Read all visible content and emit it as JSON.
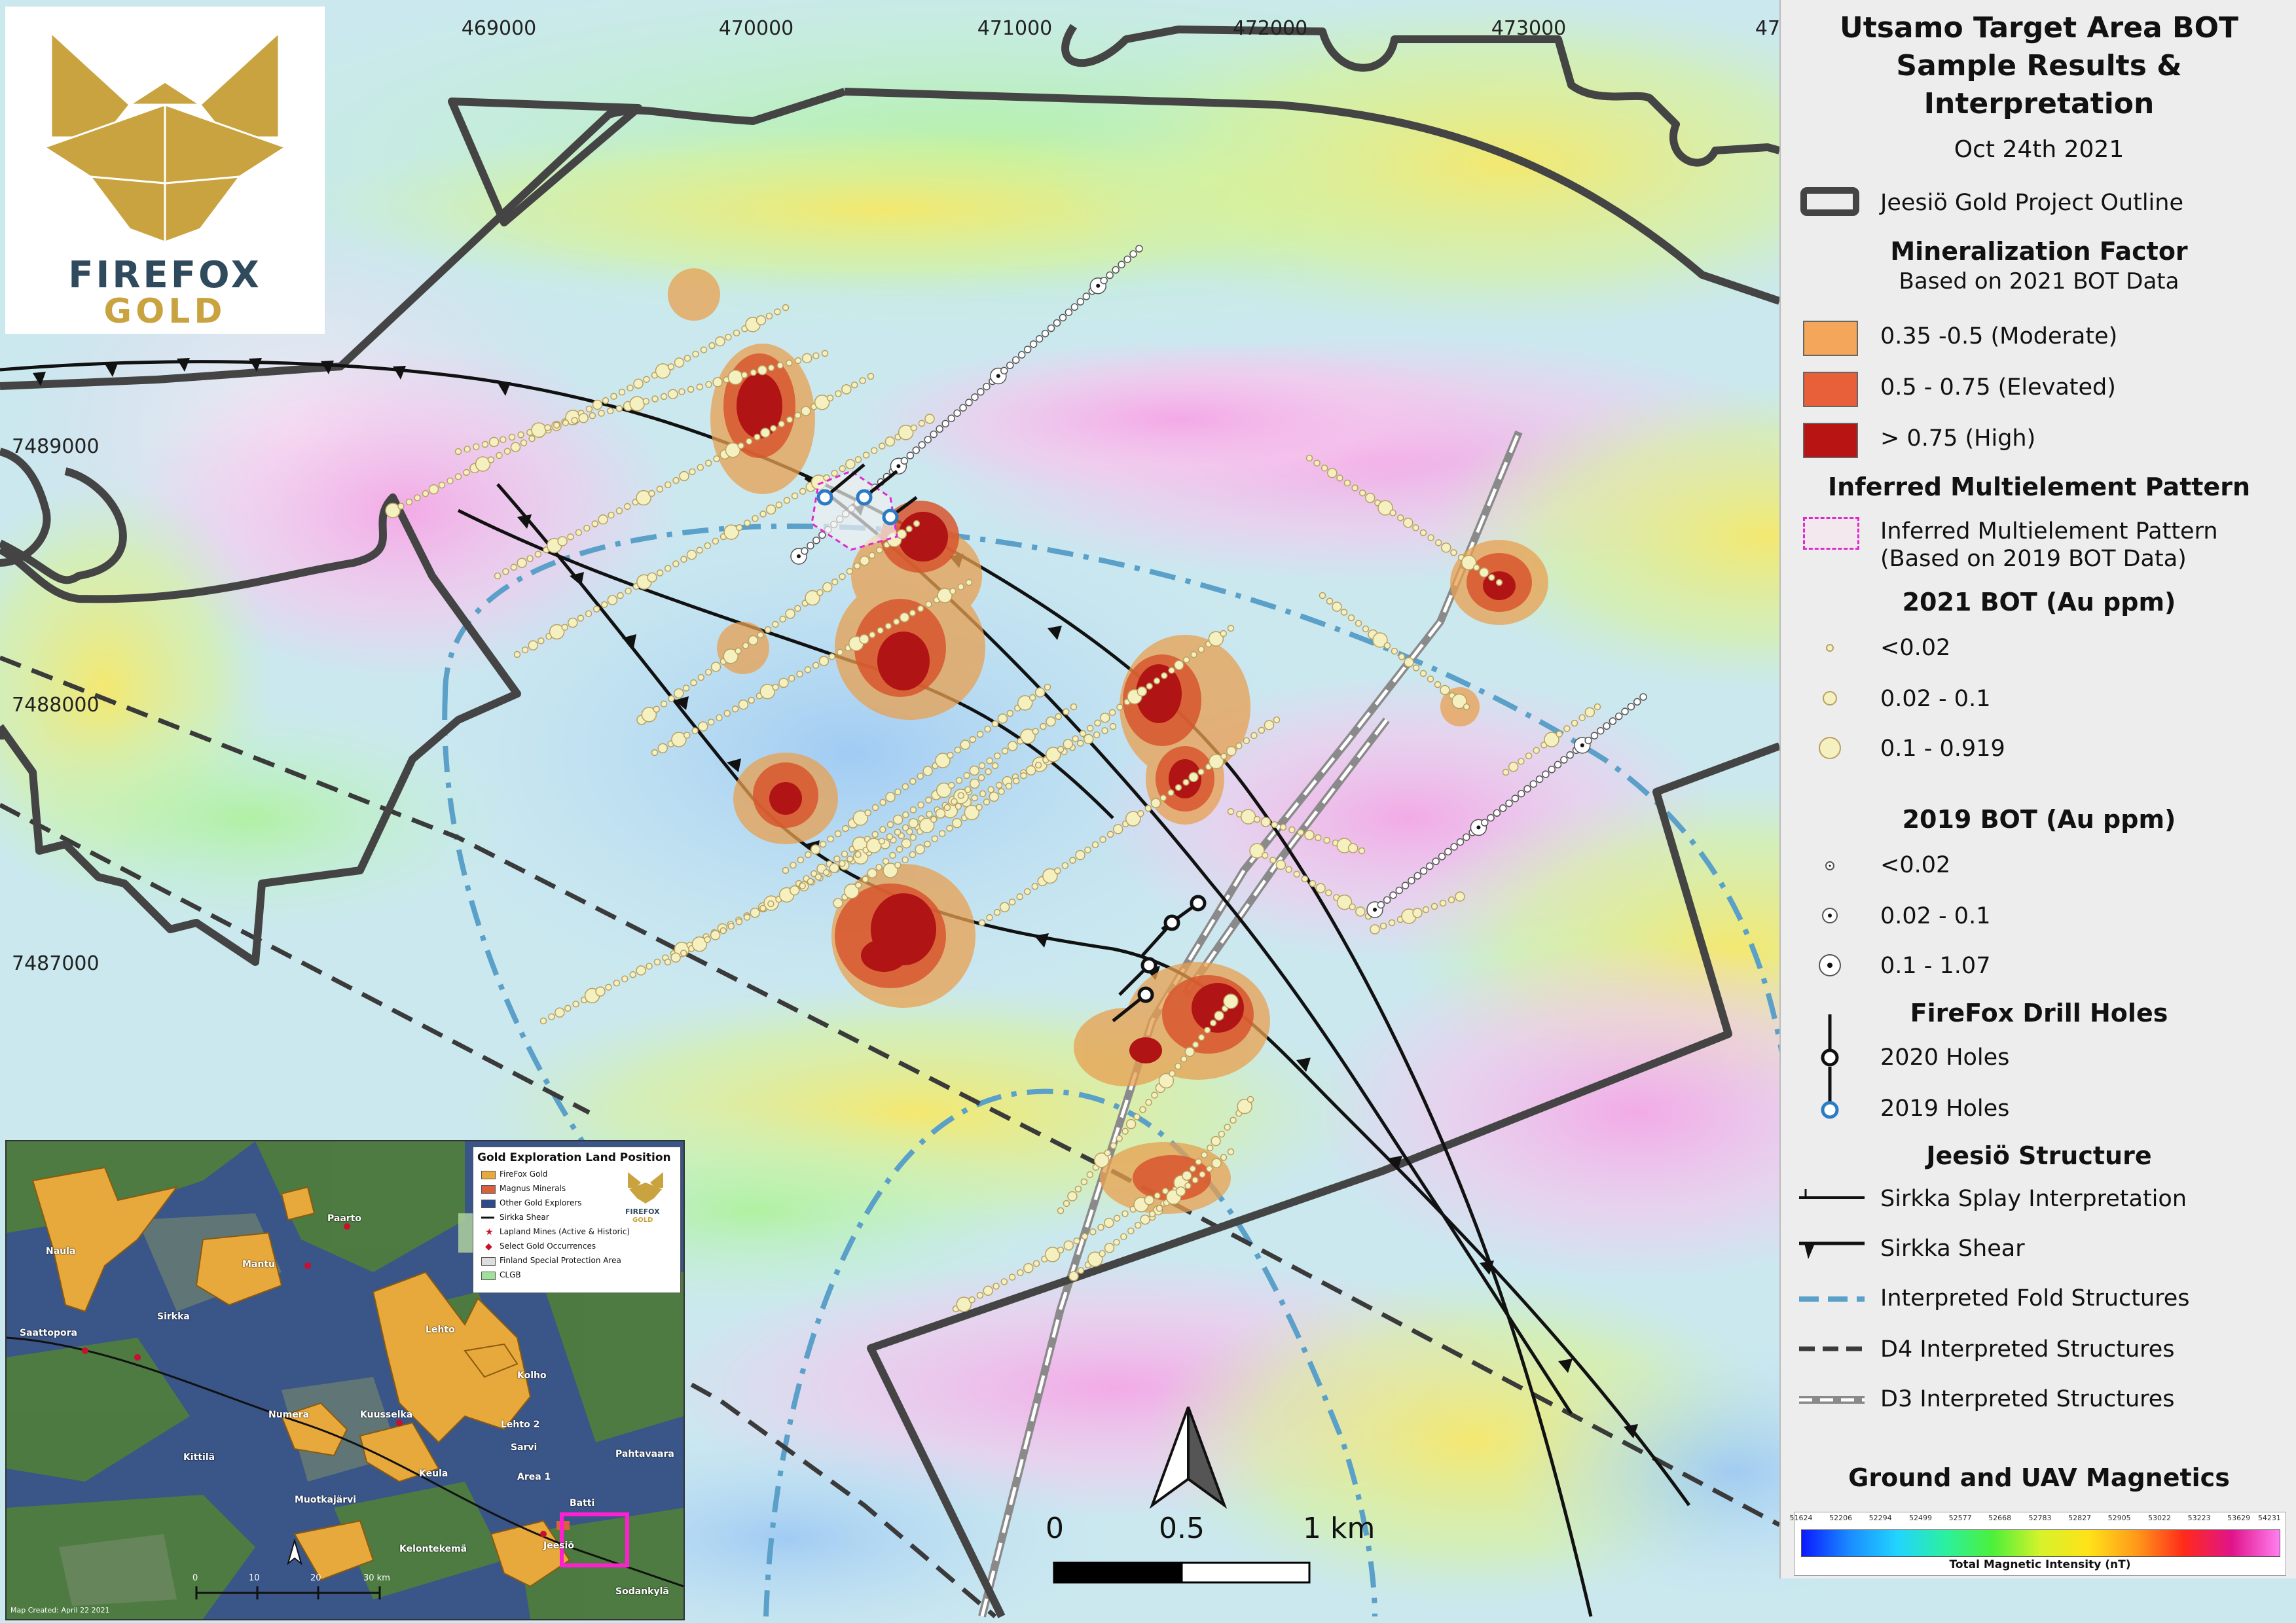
{
  "map": {
    "x_coords": [
      "469000",
      "470000",
      "471000",
      "472000",
      "473000",
      "47"
    ],
    "y_coords": [
      "7489000",
      "7488000",
      "7487000"
    ],
    "north_arrow": "north-arrow",
    "scale": {
      "zero": "0",
      "half": "0.5",
      "one": "1 km"
    }
  },
  "logo": {
    "line1": "FIREFOX",
    "line2": "GOLD",
    "primary_color": "#c9a33f",
    "text_color": "#2f4a5c"
  },
  "legend": {
    "title_lines": [
      "Utsamo Target Area BOT",
      "Sample Results &",
      "Interpretation"
    ],
    "date": "Oct 24th 2021",
    "outline_label": "Jeesiö Gold Project Outline",
    "mineralization": {
      "title": "Mineralization Factor",
      "subtitle": "Based on 2021 BOT Data",
      "classes": [
        {
          "label": "0.35 -0.5 (Moderate)",
          "color": "#f4a75a"
        },
        {
          "label": "0.5 - 0.75 (Elevated)",
          "color": "#e8603a"
        },
        {
          "label": "> 0.75 (High)",
          "color": "#b81414"
        }
      ]
    },
    "multielement": {
      "title": "Inferred Multielement Pattern",
      "line1": "Inferred Multielement Pattern",
      "line2": "(Based on 2019 BOT Data)"
    },
    "bot2021": {
      "title": "2021 BOT (Au ppm)",
      "classes": [
        "<0.02",
        "0.02 - 0.1",
        "0.1 - 0.919"
      ]
    },
    "bot2019": {
      "title": "2019 BOT (Au ppm)",
      "classes": [
        "<0.02",
        "0.02 - 0.1",
        "0.1 - 1.07"
      ]
    },
    "drill": {
      "title": "FireFox Drill Holes",
      "holes2020": "2020 Holes",
      "holes2019": "2019 Holes"
    },
    "structure": {
      "title": "Jeesiö Structure",
      "items": [
        "Sirkka Splay Interpretation",
        "Sirkka Shear",
        "Interpreted Fold Structures",
        "D4 Interpreted Structures",
        "D3 Interpreted Structures"
      ],
      "fold_color": "#5aa0c8"
    },
    "magnetics": {
      "title": "Ground and UAV Magnetics",
      "ticks": [
        "51624",
        "52206",
        "52294",
        "52499",
        "52577",
        "52668",
        "52783",
        "52827",
        "52905",
        "53022",
        "53223",
        "53629",
        "54231"
      ],
      "label": "Total Magnetic Intensity (nT)"
    }
  },
  "inset": {
    "title": "Gold Exploration Land Position",
    "legend_items": [
      {
        "label": "FireFox Gold",
        "color": "#e8a93c"
      },
      {
        "label": "Magnus Minerals",
        "color": "#d9603a"
      },
      {
        "label": "Other Gold Explorers",
        "color": "#2f4a8a"
      },
      {
        "label": "Sirkka Shear",
        "color": "#111111"
      },
      {
        "label": "Lapland Mines (Active & Historic)",
        "color": "#c8102e"
      },
      {
        "label": "Select Gold Occurrences",
        "color": "#c8102e"
      },
      {
        "label": "Finland Special Protection Area",
        "color": "#dddddd"
      },
      {
        "label": "CLGB",
        "color": "#9fe09a"
      }
    ],
    "logo_line1": "FIREFOX",
    "logo_line2": "GOLD",
    "place_labels": [
      "Naula",
      "Mantu",
      "Paarto",
      "Lehto",
      "Kolho",
      "Numera",
      "Kuusselka",
      "Lehto 2",
      "Sarvi",
      "Keula",
      "Muotkajärvi",
      "Kelontekemä",
      "Jeesiö",
      "Sodankylä",
      "Kittilä",
      "Saattopora",
      "Sirkka",
      "Pahtavaara",
      "Area 1",
      "Batti"
    ],
    "scale_labels": [
      "0",
      "10",
      "20",
      "30 km"
    ],
    "credit": "Map Created: April 22 2021"
  }
}
